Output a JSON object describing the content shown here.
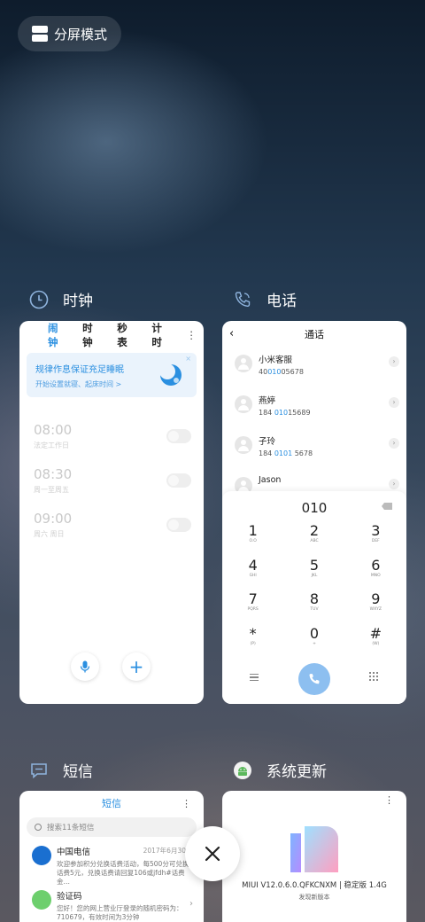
{
  "split_screen": {
    "label": "分屏模式"
  },
  "close_icon": "close-icon",
  "apps": {
    "clock": {
      "title": "时钟",
      "tabs": [
        "闹钟",
        "时钟",
        "秒表",
        "计时"
      ],
      "more": "⋮",
      "banner_title": "规律作息保证充足睡眠",
      "banner_sub": "开始设置就寝、起床时间 >",
      "banner_close": "×",
      "alarms": [
        {
          "time": "08:00",
          "label": "法定工作日"
        },
        {
          "time": "08:30",
          "label": "周一至周五"
        },
        {
          "time": "09:00",
          "label": "周六 周日"
        }
      ],
      "add_label": "+"
    },
    "phone": {
      "title": "电话",
      "screen_title": "通话",
      "back": "‹",
      "contacts": [
        {
          "name": "小米客服",
          "pre": "40",
          "hl": "010",
          "post": "05678"
        },
        {
          "name": "燕婷",
          "pre": "184 ",
          "hl": "010",
          "post": "15689"
        },
        {
          "name": "子玲",
          "pre": "184 ",
          "hl": "0101",
          "post": " 5678"
        },
        {
          "name": "Jason",
          "pre": "",
          "hl": "",
          "post": ""
        }
      ],
      "arrow": "›",
      "dialed": "010",
      "keys": [
        {
          "d": "1",
          "s": "O.O"
        },
        {
          "d": "2",
          "s": "ABC"
        },
        {
          "d": "3",
          "s": "DEF"
        },
        {
          "d": "4",
          "s": "GHI"
        },
        {
          "d": "5",
          "s": "JKL"
        },
        {
          "d": "6",
          "s": "MNO"
        },
        {
          "d": "7",
          "s": "PQRS"
        },
        {
          "d": "8",
          "s": "TUV"
        },
        {
          "d": "9",
          "s": "WXYZ"
        },
        {
          "d": "*",
          "s": "(P)"
        },
        {
          "d": "0",
          "s": "+"
        },
        {
          "d": "#",
          "s": "(W)"
        }
      ]
    },
    "sms": {
      "title": "短信",
      "screen_title": "短信",
      "more": "⋮",
      "search_placeholder": "搜索11条短信",
      "messages": [
        {
          "name": "中国电信",
          "time": "2017年6月30",
          "body": "欢迎参加积分兑换话费活动，每500分可兑换话费5元，兑换话费请回复106或jfdh#话费金…",
          "color": "#1a6fd0"
        },
        {
          "name": "验证码",
          "time": "",
          "body": "您好！您的网上营业厅登录的随机密码为：710679，有效时间为3分钟",
          "color": "#6dcf6d"
        }
      ],
      "arrow": "›"
    },
    "update": {
      "title": "系统更新",
      "more": "⋮",
      "version": "MIUI V12.0.6.0.QFKCNXM | 稳定版 1.4G",
      "sub": "发现新版本"
    }
  },
  "colors": {
    "accent": "#2a8fe0",
    "call": "#8dbff0"
  }
}
